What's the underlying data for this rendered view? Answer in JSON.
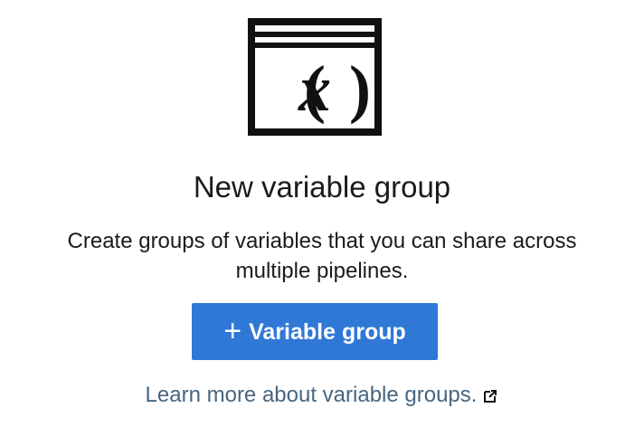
{
  "empty_state": {
    "icon": "variable-window-icon",
    "title": "New variable group",
    "description": "Create groups of variables that you can share across multiple pipelines.",
    "primary_button": {
      "label": "Variable group",
      "icon": "plus-icon",
      "color": "#2f78d6"
    },
    "learn_more": {
      "text": "Learn more about variable groups.",
      "icon": "external-link-icon",
      "color": "#486581"
    }
  }
}
